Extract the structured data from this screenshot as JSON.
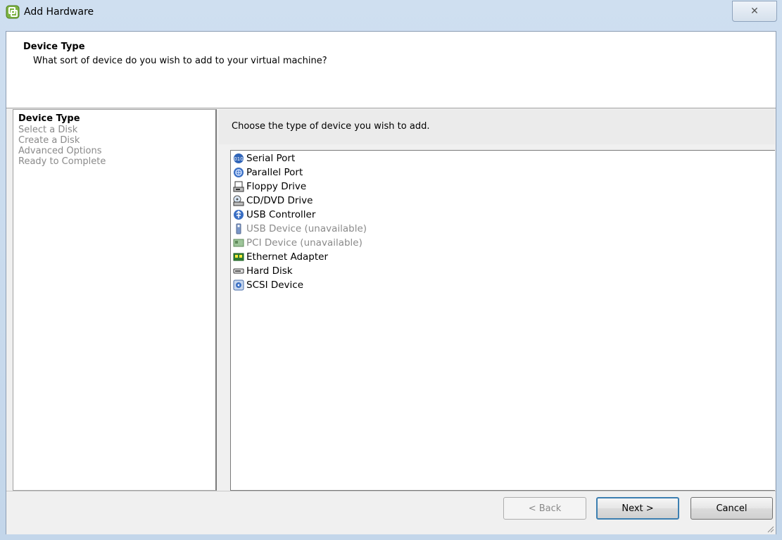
{
  "window": {
    "title": "Add Hardware",
    "close_symbol": "✕"
  },
  "header": {
    "title": "Device Type",
    "subtitle": "What sort of device do you wish to add to your virtual machine?"
  },
  "steps": [
    {
      "label": "Device Type",
      "active": true
    },
    {
      "label": "Select a Disk",
      "active": false
    },
    {
      "label": "Create a Disk",
      "active": false
    },
    {
      "label": "Advanced Options",
      "active": false
    },
    {
      "label": "Ready to Complete",
      "active": false
    }
  ],
  "content": {
    "instruction": "Choose the type of device you wish to add."
  },
  "devices": [
    {
      "label": "Serial Port",
      "icon": "serial-port-icon",
      "available": true
    },
    {
      "label": "Parallel Port",
      "icon": "parallel-port-icon",
      "available": true
    },
    {
      "label": "Floppy Drive",
      "icon": "floppy-drive-icon",
      "available": true
    },
    {
      "label": "CD/DVD Drive",
      "icon": "cd-dvd-drive-icon",
      "available": true
    },
    {
      "label": "USB Controller",
      "icon": "usb-controller-icon",
      "available": true
    },
    {
      "label": "USB Device (unavailable)",
      "icon": "usb-device-icon",
      "available": false
    },
    {
      "label": "PCI Device (unavailable)",
      "icon": "pci-device-icon",
      "available": false
    },
    {
      "label": "Ethernet Adapter",
      "icon": "ethernet-adapter-icon",
      "available": true
    },
    {
      "label": "Hard Disk",
      "icon": "hard-disk-icon",
      "available": true
    },
    {
      "label": "SCSI Device",
      "icon": "scsi-device-icon",
      "available": true
    }
  ],
  "buttons": {
    "back": "< Back",
    "next": "Next >",
    "cancel": "Cancel"
  },
  "colors": {
    "accent": "#3c7fb1",
    "disabled_text": "#8a8a8a",
    "window_frame": "#c3d6ea"
  }
}
